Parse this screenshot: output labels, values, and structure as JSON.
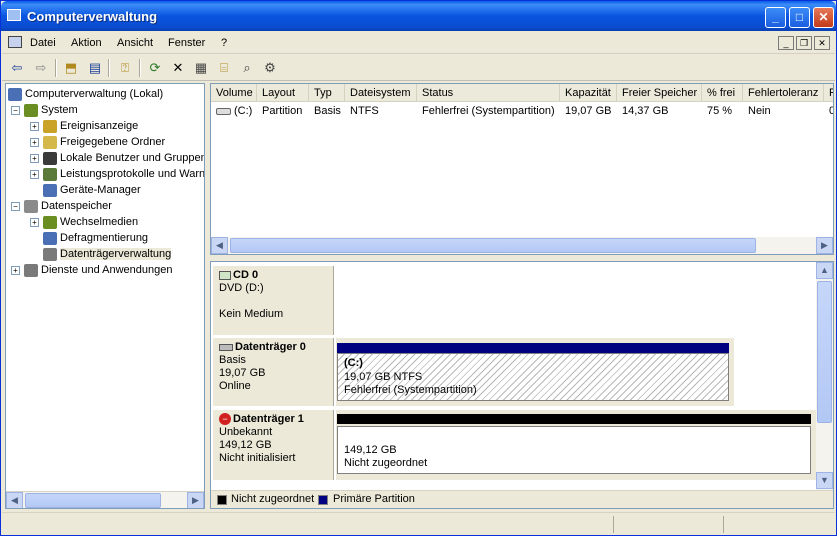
{
  "window": {
    "title": "Computerverwaltung"
  },
  "menu": {
    "items": [
      {
        "label": "Datei"
      },
      {
        "label": "Aktion"
      },
      {
        "label": "Ansicht"
      },
      {
        "label": "Fenster"
      },
      {
        "label": "?"
      }
    ]
  },
  "toolbar": {
    "icons": [
      "back-icon",
      "forward-icon",
      "up-folder-icon",
      "show-hide-tree-icon",
      "help-icon",
      "refresh-icon",
      "delete-icon",
      "properties-icon",
      "open-icon",
      "search-icon",
      "settings-icon"
    ]
  },
  "tree": {
    "items": [
      {
        "label": "Computerverwaltung (Lokal)",
        "level": 0,
        "expander": "",
        "color": "#4a6fb5"
      },
      {
        "label": "System",
        "level": 1,
        "expander": "−",
        "color": "#6b8e23"
      },
      {
        "label": "Ereignisanzeige",
        "level": 2,
        "expander": "+",
        "color": "#c9a227"
      },
      {
        "label": "Freigegebene Ordner",
        "level": 2,
        "expander": "+",
        "color": "#d4b84a"
      },
      {
        "label": "Lokale Benutzer und Gruppen",
        "level": 2,
        "expander": "+",
        "color": "#3a3a3a"
      },
      {
        "label": "Leistungsprotokolle und Warn",
        "level": 2,
        "expander": "+",
        "color": "#5a7a3a"
      },
      {
        "label": "Geräte-Manager",
        "level": 2,
        "expander": "",
        "color": "#4a6fb5"
      },
      {
        "label": "Datenspeicher",
        "level": 1,
        "expander": "−",
        "color": "#8a8a8a"
      },
      {
        "label": "Wechselmedien",
        "level": 2,
        "expander": "+",
        "color": "#6b8e23"
      },
      {
        "label": "Defragmentierung",
        "level": 2,
        "expander": "",
        "color": "#4a6fb5"
      },
      {
        "label": "Datenträgerverwaltung",
        "level": 2,
        "expander": "",
        "color": "#7a7a7a"
      },
      {
        "label": "Dienste und Anwendungen",
        "level": 1,
        "expander": "+",
        "color": "#7a7a7a"
      }
    ]
  },
  "volumes": {
    "columns": [
      "Volume",
      "Layout",
      "Typ",
      "Dateisystem",
      "Status",
      "Kapazität",
      "Freier Speicher",
      "% frei",
      "Fehlertoleranz",
      "F"
    ],
    "rows": [
      [
        "(C:)",
        "Partition",
        "Basis",
        "NTFS",
        "Fehlerfrei (Systempartition)",
        "19,07 GB",
        "14,37 GB",
        "75 %",
        "Nein",
        "0"
      ]
    ]
  },
  "disks": [
    {
      "name": "CD 0",
      "line1": "DVD (D:)",
      "line2": "",
      "line3": "Kein Medium"
    },
    {
      "name": "Datenträger 0",
      "line1": "Basis",
      "line2": "19,07 GB",
      "line3": "Online",
      "volume": {
        "title": "(C:)",
        "size": "19,07 GB NTFS",
        "status": "Fehlerfrei (Systempartition)"
      }
    },
    {
      "name": "Datenträger 1",
      "line1": "Unbekannt",
      "line2": "149,12 GB",
      "line3": "Nicht initialisiert",
      "volume": {
        "size": "149,12 GB",
        "status": "Nicht zugeordnet"
      }
    }
  ],
  "legend": {
    "unallocated": "Nicht zugeordnet",
    "primary": "Primäre Partition",
    "unallocated_color": "#000000",
    "primary_color": "#000080"
  }
}
